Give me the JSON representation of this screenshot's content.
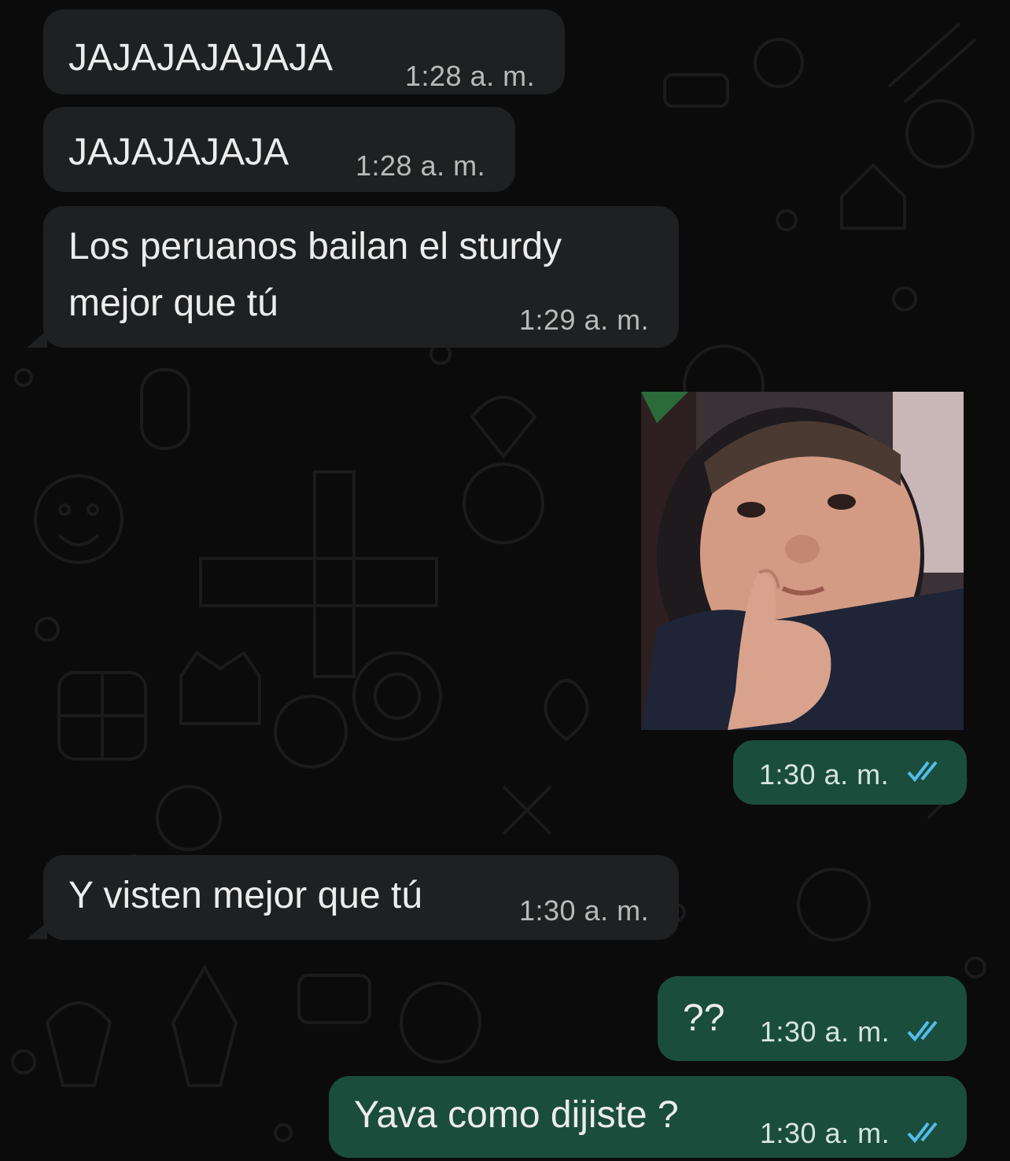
{
  "chat": {
    "messages": [
      {
        "direction": "incoming",
        "text": "JAJAJAJAJAJA",
        "time": "1:28 a. m."
      },
      {
        "direction": "incoming",
        "text": "JAJAJAJAJA",
        "time": "1:28 a. m."
      },
      {
        "direction": "incoming",
        "text_line1": "Los peruanos bailan el sturdy",
        "text_line2": "mejor que tú",
        "time": "1:29 a. m."
      },
      {
        "direction": "outgoing",
        "type": "image",
        "image_description": "sticker-baby-thumbs-up",
        "time": "1:30 a. m.",
        "status": "read"
      },
      {
        "direction": "incoming",
        "text": "Y visten mejor que tú",
        "time": "1:30 a. m."
      },
      {
        "direction": "outgoing",
        "text": "??",
        "time": "1:30 a. m.",
        "status": "read"
      },
      {
        "direction": "outgoing",
        "text": "Yava como dijiste ?",
        "time": "1:30 a. m.",
        "status": "read"
      }
    ]
  },
  "colors": {
    "background": "#0b0b0b",
    "incoming_bubble": "#1f2021",
    "outgoing_bubble": "#1a4d3c",
    "read_ticks": "#53bdeb"
  }
}
